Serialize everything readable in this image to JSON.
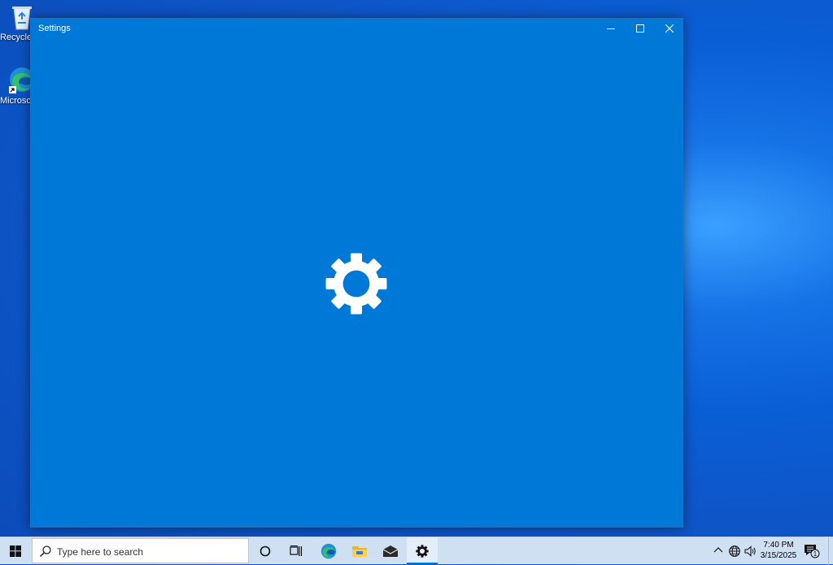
{
  "desktop": {
    "icons": [
      {
        "label": "Recycle Bin"
      },
      {
        "label": "Microsoft Edge"
      }
    ]
  },
  "window": {
    "title": "Settings",
    "controls": [
      "minimize-icon",
      "maximize-icon",
      "close-icon"
    ],
    "splash_icon": "gear-icon",
    "background": "#0078d7"
  },
  "taskbar": {
    "search_placeholder": "Type here to search",
    "apps": [
      "cortana-icon",
      "task-view-icon",
      "edge-icon",
      "file-explorer-icon",
      "mail-icon",
      "settings-icon"
    ],
    "active_app": "settings-icon",
    "tray": {
      "time": "7:40 PM",
      "date": "3/15/2025",
      "notification_count": "1"
    }
  }
}
